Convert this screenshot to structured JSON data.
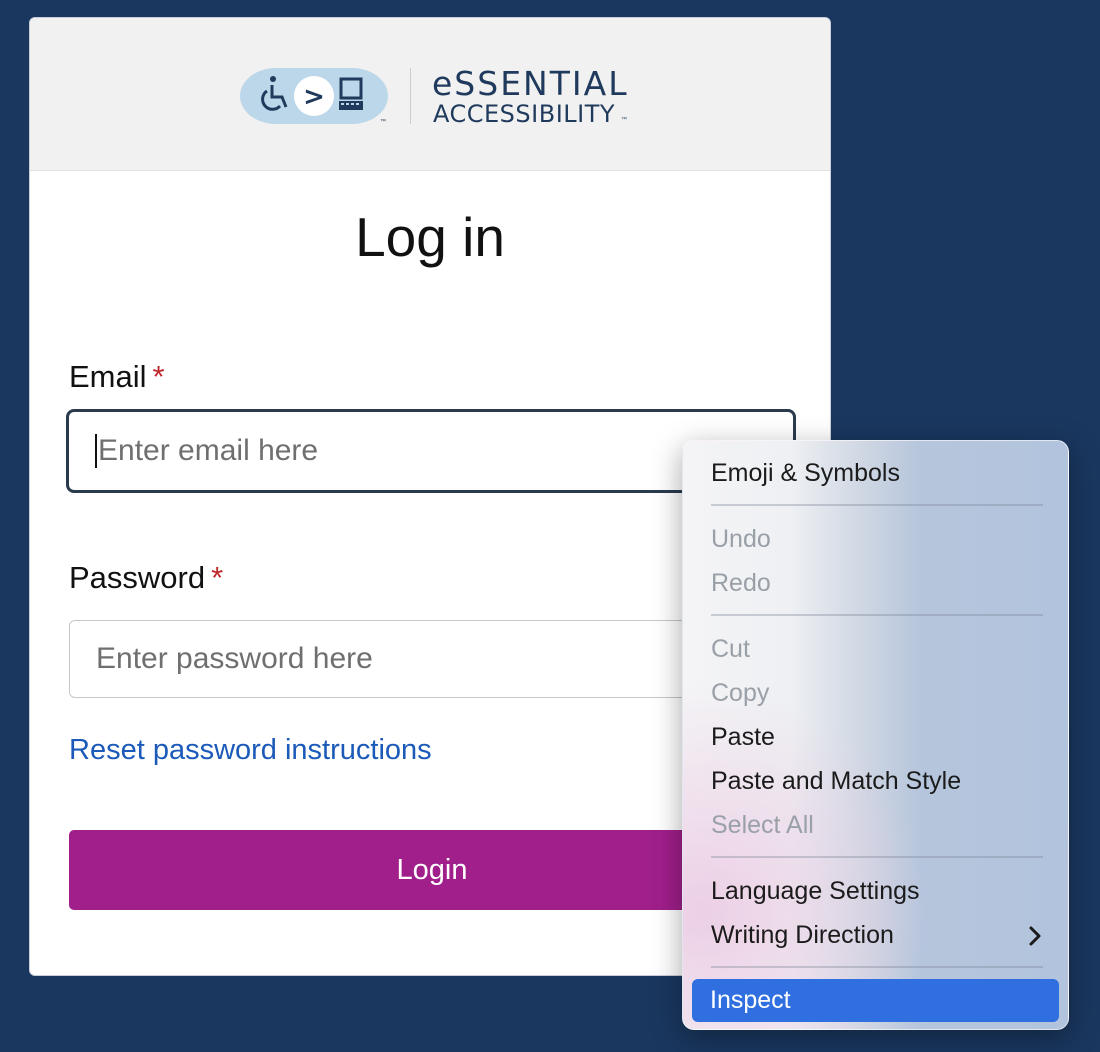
{
  "logo": {
    "line1": "eSSENTIAL",
    "line2": "ACCESSIBILITY",
    "tm": "™",
    "wheelchair_icon": "wheelchair-icon",
    "arrow_glyph": ">",
    "computer_icon": "computer-icon"
  },
  "form": {
    "title": "Log in",
    "email_label": "Email",
    "email_placeholder": "Enter email here",
    "password_label": "Password",
    "password_placeholder": "Enter password here",
    "required_mark": "*",
    "reset_link": "Reset password instructions",
    "login_button": "Login"
  },
  "context_menu": {
    "items": [
      {
        "label": "Emoji & Symbols",
        "enabled": true
      },
      {
        "label": "Undo",
        "enabled": false
      },
      {
        "label": "Redo",
        "enabled": false
      },
      {
        "label": "Cut",
        "enabled": false
      },
      {
        "label": "Copy",
        "enabled": false
      },
      {
        "label": "Paste",
        "enabled": true
      },
      {
        "label": "Paste and Match Style",
        "enabled": true
      },
      {
        "label": "Select All",
        "enabled": false
      },
      {
        "label": "Language Settings",
        "enabled": true
      },
      {
        "label": "Writing Direction",
        "enabled": true,
        "submenu": true
      },
      {
        "label": "Inspect",
        "enabled": true,
        "highlighted": true
      }
    ],
    "submenu_glyph": "›"
  },
  "colors": {
    "background": "#1a375f",
    "login_button": "#a01f8a",
    "link": "#1b5ab8",
    "required": "#c0282b",
    "menu_highlight": "#2f6fdf"
  }
}
